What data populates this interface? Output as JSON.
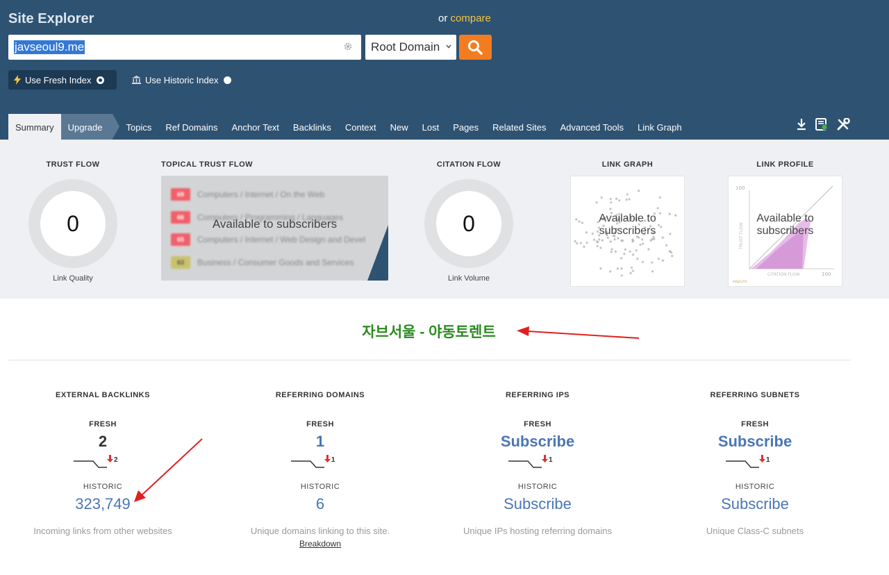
{
  "header": {
    "title": "Site Explorer",
    "compare_prefix": "or",
    "compare_link": "compare",
    "search_value": "javseoul9.me",
    "scope_select": "Root Domain",
    "fresh_index_label": "Use Fresh Index",
    "historic_index_label": "Use Historic Index"
  },
  "tabs": [
    "Summary",
    "Upgrade",
    "Topics",
    "Ref Domains",
    "Anchor Text",
    "Backlinks",
    "Context",
    "New",
    "Lost",
    "Pages",
    "Related Sites",
    "Advanced Tools",
    "Link Graph"
  ],
  "metrics": {
    "trust_flow": {
      "heading": "TRUST FLOW",
      "value": "0",
      "sub": "Link Quality"
    },
    "topical_trust_flow": {
      "heading": "TOPICAL TRUST FLOW",
      "overlay": "Available to subscribers",
      "rows": [
        {
          "badge": "69",
          "category": "Computers / Internet / On the Web",
          "color": "#f0606a"
        },
        {
          "badge": "66",
          "category": "Computers / Programming / Languages",
          "color": "#f0606a"
        },
        {
          "badge": "65",
          "category": "Computers / Internet / Web Design and Devel",
          "color": "#f0606a"
        },
        {
          "badge": "63",
          "category": "Business / Consumer Goods and Services",
          "color": "#c9c26a"
        }
      ]
    },
    "citation_flow": {
      "heading": "CITATION FLOW",
      "value": "0",
      "sub": "Link Volume"
    },
    "link_graph": {
      "heading": "LINK GRAPH",
      "overlay": "Available to subscribers"
    },
    "link_profile": {
      "heading": "LINK PROFILE",
      "overlay": "Available to subscribers",
      "y_label": "TRUST FLOW",
      "x_label": "CITATION FLOW",
      "y_max": "100",
      "x_max": "100",
      "brand": "MAJESTIC"
    }
  },
  "site_title": "자브서울 - 야동토렌트",
  "stats": [
    {
      "heading": "EXTERNAL BACKLINKS",
      "fresh_label": "FRESH",
      "fresh_value": "2",
      "delta": "2",
      "historic_label": "HISTORIC",
      "historic_value": "323,749",
      "desc": "Incoming links from other websites",
      "link": ""
    },
    {
      "heading": "REFERRING DOMAINS",
      "fresh_label": "FRESH",
      "fresh_value": "1",
      "delta": "1",
      "historic_label": "HISTORIC",
      "historic_value": "6",
      "desc": "Unique domains linking to this site.",
      "link": "Breakdown"
    },
    {
      "heading": "REFERRING IPS",
      "fresh_label": "FRESH",
      "fresh_value": "Subscribe",
      "delta": "1",
      "historic_label": "HISTORIC",
      "historic_value": "Subscribe",
      "desc": "Unique IPs hosting referring domains",
      "link": ""
    },
    {
      "heading": "REFERRING SUBNETS",
      "fresh_label": "FRESH",
      "fresh_value": "Subscribe",
      "delta": "1",
      "historic_label": "HISTORIC",
      "historic_value": "Subscribe",
      "desc": "Unique Class-C subnets",
      "link": ""
    }
  ],
  "colors": {
    "header_bg": "#2e5272",
    "accent_orange": "#f47c20",
    "link_blue": "#4a76b4",
    "title_green": "#2a8a1e",
    "annotation_red": "#e02020"
  }
}
